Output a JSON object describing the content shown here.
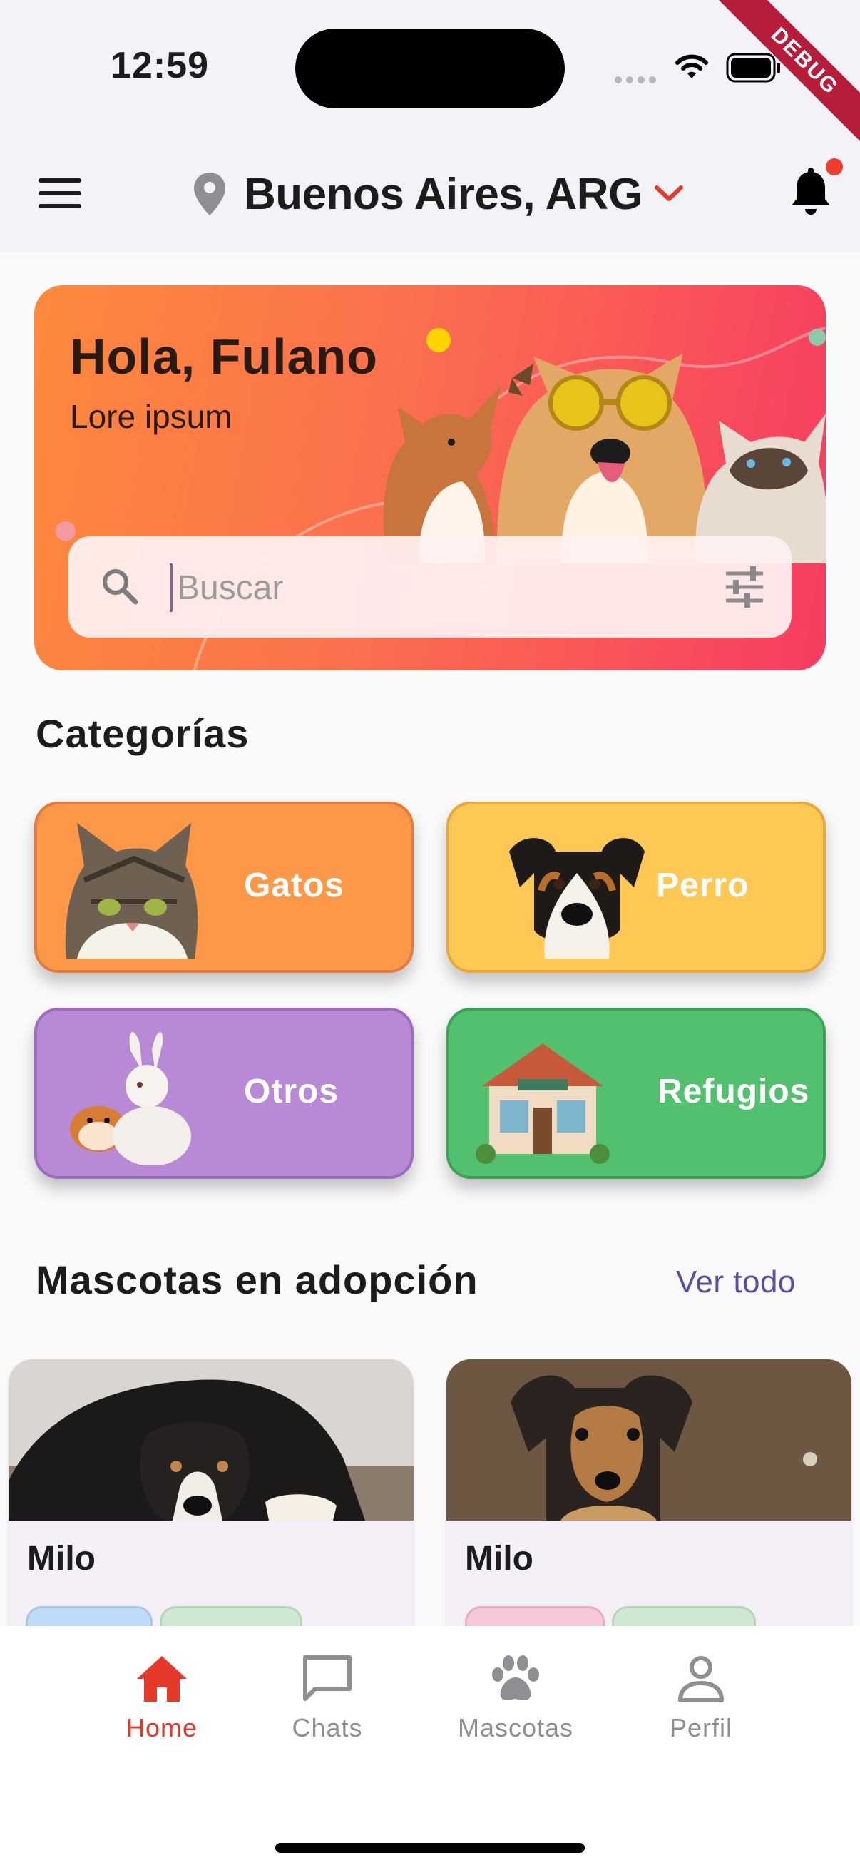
{
  "status_bar": {
    "time": "12:59",
    "debug_banner": "DEBUG"
  },
  "app_bar": {
    "location": "Buenos Aires, ARG"
  },
  "hero": {
    "greeting": "Hola, Fulano",
    "subtitle": "Lore ipsum",
    "search_placeholder": "Buscar"
  },
  "categories": {
    "title": "Categorías",
    "items": [
      {
        "label": "Gatos",
        "color": "#fd9849",
        "border": "#e37a3e"
      },
      {
        "label": "Perro",
        "color": "#fec854",
        "border": "#e7a93a"
      },
      {
        "label": "Otros",
        "color": "#b889d4",
        "border": "#9b6cc0"
      },
      {
        "label": "Refugios",
        "color": "#52c06e",
        "border": "#3ba356"
      }
    ]
  },
  "adoption": {
    "title": "Mascotas en adopción",
    "view_all": "Ver todo",
    "pets": [
      {
        "name": "Milo"
      },
      {
        "name": "Milo"
      }
    ]
  },
  "bottom_nav": {
    "items": [
      {
        "label": "Home",
        "icon": "home-icon",
        "active": true
      },
      {
        "label": "Chats",
        "icon": "chat-icon",
        "active": false
      },
      {
        "label": "Mascotas",
        "icon": "paw-icon",
        "active": false
      },
      {
        "label": "Perfil",
        "icon": "person-icon",
        "active": false
      }
    ],
    "active_color": "#e5392a",
    "inactive_color": "#8e8e93"
  }
}
